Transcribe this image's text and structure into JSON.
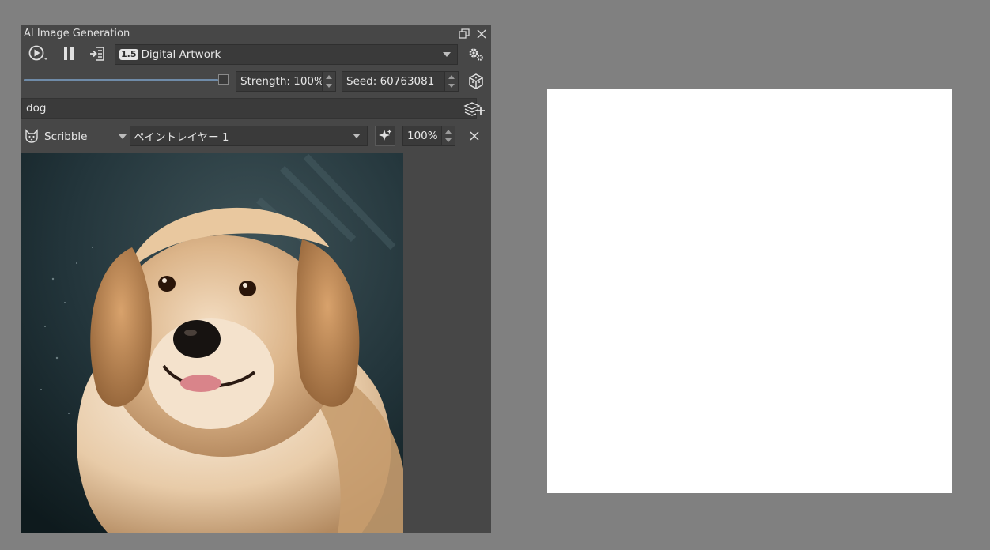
{
  "panel": {
    "title": "AI Image Generation",
    "toolbar": {
      "generate_icon": "play-circle-icon",
      "pause_icon": "pause-icon",
      "apply_icon": "apply-to-canvas-icon",
      "style_badge": "1.5",
      "style_label": "Digital Artwork",
      "settings_icon": "gears-icon"
    },
    "strength": {
      "value_fraction": 1.0,
      "label": "Strength: 100%"
    },
    "seed": {
      "label": "Seed: 60763081",
      "icon": "dice-cube-icon"
    },
    "prompt": {
      "value": "dog",
      "add_layer_icon": "layers-add-icon"
    },
    "control": {
      "icon": "cat-face-icon",
      "type_label": "Scribble",
      "layer_label": "ペイントレイヤー 1",
      "sparkle_icon": "sparkle-icon",
      "strength_label": "100%",
      "remove_icon": "close-icon"
    },
    "preview_image": "golden retriever puppy"
  },
  "colors": {
    "panel_bg": "#474747",
    "workspace_bg": "#808080",
    "canvas_bg": "#ffffff",
    "slider_accent": "#6f8ba8"
  }
}
